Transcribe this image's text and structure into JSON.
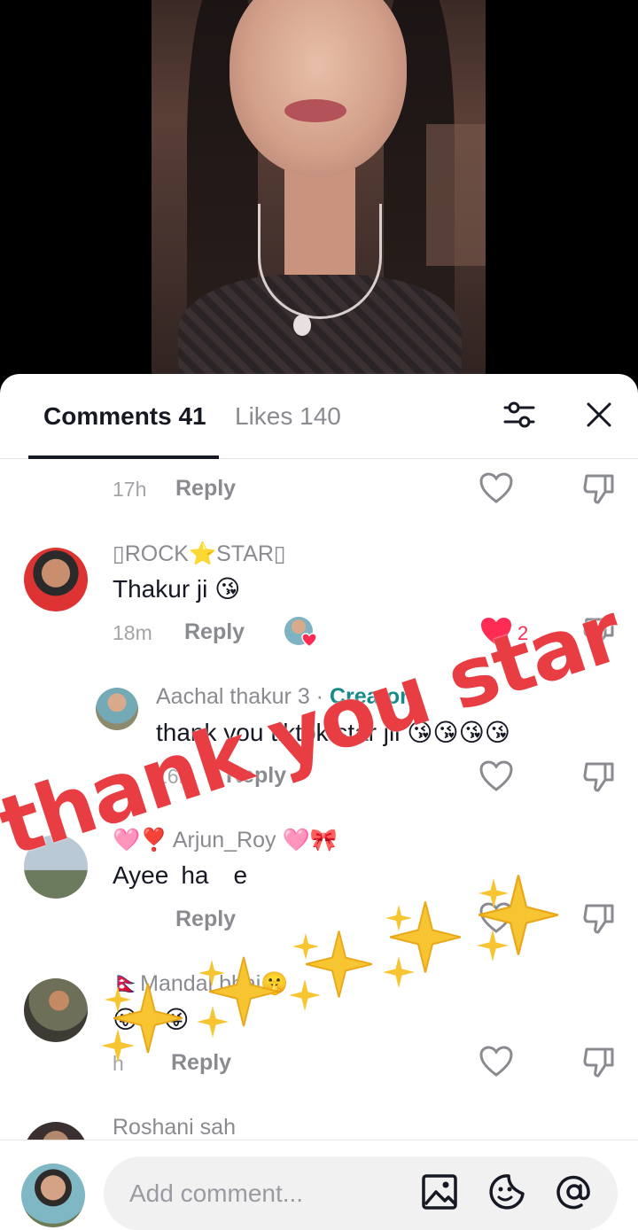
{
  "tabs": {
    "comments": "Comments 41",
    "likes": "Likes 140"
  },
  "comments": [
    {
      "time": "17h",
      "reply": "Reply"
    },
    {
      "user": "▯ROCK⭐STAR▯",
      "text": "Thakur ji 😘",
      "time": "18m",
      "reply": "Reply",
      "likes": "2",
      "liked": true,
      "replies": [
        {
          "user": "Aachal thakur 3",
          "sep": " · ",
          "badge": "Creator",
          "text": "thank you tiktok star jii 😘😘😘😘",
          "time": "16m",
          "reply": "Reply"
        }
      ]
    },
    {
      "user": "🩷❣️ Arjun_Roy 🩷🎀",
      "text": "Ayee ha  e",
      "reply": "Reply"
    },
    {
      "user": "🇳🇵Mandal bhai🤫",
      "text": "😜  😜",
      "time": "h",
      "reply": "Reply"
    },
    {
      "user": "Roshani sah"
    }
  ],
  "input": {
    "placeholder": "Add comment..."
  },
  "overlay": {
    "text": "thank you star jii"
  },
  "colors": {
    "accent_like": "#fe2c55",
    "creator": "#168a8a",
    "overlay": "#e83d43"
  },
  "icons": [
    "filter-icon",
    "close-icon",
    "heart-icon",
    "dislike-icon",
    "image-icon",
    "emoji-icon",
    "mention-icon",
    "sparkle-icon"
  ]
}
